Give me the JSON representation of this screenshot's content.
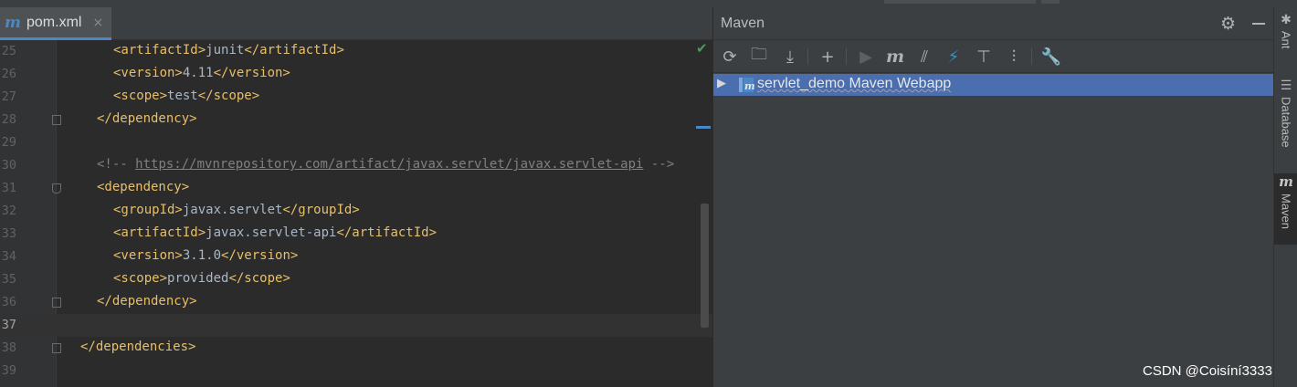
{
  "editor": {
    "tab": {
      "icon": "maven-m-icon",
      "label": "pom.xml",
      "close": "×"
    },
    "lines": [
      {
        "n": "25",
        "indent": 3,
        "parts": [
          [
            "tag",
            "<artifactId>"
          ],
          [
            "text",
            "junit"
          ],
          [
            "tag",
            "</artifactId>"
          ]
        ]
      },
      {
        "n": "26",
        "indent": 3,
        "parts": [
          [
            "tag",
            "<version>"
          ],
          [
            "text",
            "4.11"
          ],
          [
            "tag",
            "</version>"
          ]
        ]
      },
      {
        "n": "27",
        "indent": 3,
        "parts": [
          [
            "tag",
            "<scope>"
          ],
          [
            "text",
            "test"
          ],
          [
            "tag",
            "</scope>"
          ]
        ]
      },
      {
        "n": "28",
        "indent": 2,
        "parts": [
          [
            "tag",
            "</dependency>"
          ]
        ],
        "fold": "close"
      },
      {
        "n": "29",
        "indent": 0,
        "parts": []
      },
      {
        "n": "30",
        "indent": 2,
        "parts": [
          [
            "comment",
            "<!-- "
          ],
          [
            "url",
            "https://mvnrepository.com/artifact/javax.servlet/javax.servlet-api"
          ],
          [
            "comment",
            " -->"
          ]
        ]
      },
      {
        "n": "31",
        "indent": 2,
        "parts": [
          [
            "tag",
            "<dependency>"
          ]
        ],
        "fold": "open"
      },
      {
        "n": "32",
        "indent": 3,
        "parts": [
          [
            "tag",
            "<groupId>"
          ],
          [
            "text",
            "javax.servlet"
          ],
          [
            "tag",
            "</groupId>"
          ]
        ]
      },
      {
        "n": "33",
        "indent": 3,
        "parts": [
          [
            "tag",
            "<artifactId>"
          ],
          [
            "text",
            "javax.servlet-api"
          ],
          [
            "tag",
            "</artifactId>"
          ]
        ]
      },
      {
        "n": "34",
        "indent": 3,
        "parts": [
          [
            "tag",
            "<version>"
          ],
          [
            "text",
            "3.1.0"
          ],
          [
            "tag",
            "</version>"
          ]
        ]
      },
      {
        "n": "35",
        "indent": 3,
        "parts": [
          [
            "tag",
            "<scope>"
          ],
          [
            "text",
            "provided"
          ],
          [
            "tag",
            "</scope>"
          ]
        ]
      },
      {
        "n": "36",
        "indent": 2,
        "parts": [
          [
            "tag",
            "</dependency>"
          ]
        ],
        "fold": "close"
      },
      {
        "n": "37",
        "indent": 0,
        "parts": [],
        "current": true
      },
      {
        "n": "38",
        "indent": 1,
        "parts": [
          [
            "tag",
            "</dependencies>"
          ]
        ],
        "fold": "close"
      },
      {
        "n": "39",
        "indent": 0,
        "parts": []
      }
    ]
  },
  "maven": {
    "title": "Maven",
    "toolbar": [
      {
        "name": "reload-icon",
        "glyph": "⟳"
      },
      {
        "name": "generate-sources-icon",
        "glyph": "🗀"
      },
      {
        "name": "download-icon",
        "glyph": "⤓"
      },
      {
        "name": "add-icon",
        "glyph": "+"
      },
      {
        "name": "run-icon",
        "glyph": "▶"
      },
      {
        "name": "execute-goal-icon",
        "glyph": "m"
      },
      {
        "name": "toggle-offline-icon",
        "glyph": "⫽"
      },
      {
        "name": "skip-tests-icon",
        "glyph": "⚡"
      },
      {
        "name": "show-dependencies-icon",
        "glyph": "⊤"
      },
      {
        "name": "collapse-all-icon",
        "glyph": "⫶"
      },
      {
        "name": "settings-wrench-icon",
        "glyph": "🔧"
      }
    ],
    "tree": {
      "arrow": "▶",
      "project_label": "servlet_demo Maven Webapp"
    }
  },
  "side_stripe": {
    "ant": "Ant",
    "database": "Database",
    "maven": "Maven"
  },
  "watermark": "CSDN @Coisíní3333",
  "colors": {
    "selection": "#4b6eaf",
    "tag": "#e8bf6a",
    "accent": "#4a88c7"
  }
}
